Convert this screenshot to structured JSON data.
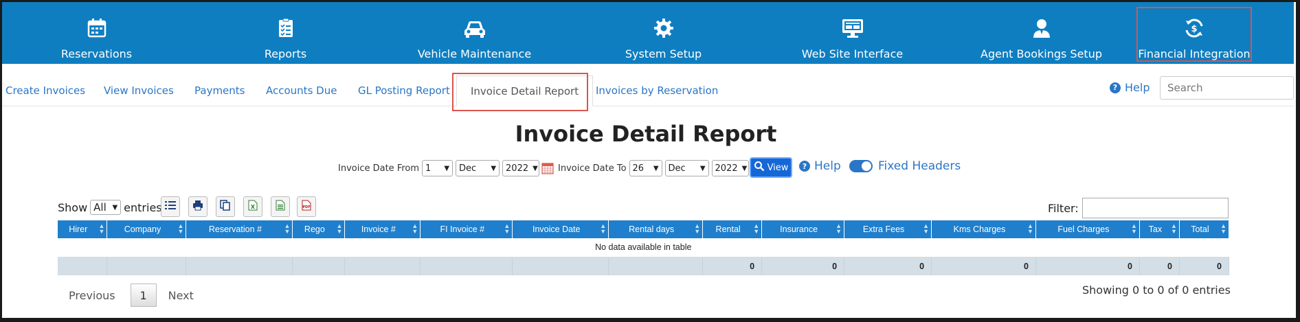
{
  "top_nav": [
    {
      "label": "Reservations",
      "icon": "calendar-icon"
    },
    {
      "label": "Reports",
      "icon": "clipboard-list-icon"
    },
    {
      "label": "Vehicle Maintenance",
      "icon": "car-icon"
    },
    {
      "label": "System Setup",
      "icon": "gear-icon"
    },
    {
      "label": "Web Site Interface",
      "icon": "monitor-icon"
    },
    {
      "label": "Agent Bookings Setup",
      "icon": "agent-icon"
    },
    {
      "label": "Financial Integration",
      "icon": "dollar-cycle-icon"
    }
  ],
  "sub_nav": {
    "tabs": [
      "Create Invoices",
      "View Invoices",
      "Payments",
      "Accounts Due",
      "GL Posting Report",
      "Invoice Detail Report",
      "Invoices by Reservation"
    ],
    "active_tab": "Invoice Detail Report",
    "help_label": "Help",
    "search_placeholder": "Search"
  },
  "report": {
    "title": "Invoice Detail Report",
    "from_label": "Invoice Date From",
    "from_day": "1",
    "from_month": "Dec",
    "from_year": "2022",
    "to_label": "Invoice Date To",
    "to_day": "26",
    "to_month": "Dec",
    "to_year": "2022",
    "view_label": "View",
    "help_label": "Help",
    "fixed_headers_label": "Fixed Headers",
    "fixed_headers_on": true
  },
  "table_controls": {
    "show_label": "Show",
    "show_value": "All",
    "entries_label": "entries",
    "filter_label": "Filter:",
    "tools": [
      "list-icon",
      "print-icon",
      "copy-icon",
      "excel-icon",
      "csv-icon",
      "pdf-icon"
    ]
  },
  "table": {
    "columns": [
      "Hirer",
      "Company",
      "Reservation #",
      "Rego",
      "Invoice #",
      "FI Invoice #",
      "Invoice Date",
      "Rental days",
      "Rental",
      "Insurance",
      "Extra Fees",
      "Kms Charges",
      "Fuel Charges",
      "Tax",
      "Total"
    ],
    "empty_message": "No data available in table",
    "footer": [
      "",
      "",
      "",
      "",
      "",
      "",
      "",
      "",
      "0",
      "0",
      "0",
      "0",
      "0",
      "0",
      "0"
    ]
  },
  "pagination": {
    "previous": "Previous",
    "page": "1",
    "next": "Next",
    "info": "Showing 0 to 0 of 0 entries"
  },
  "colors": {
    "nav_bg": "#0e7ec1",
    "link": "#2a76c6",
    "header_bg": "#1f7fcc",
    "highlight": "#d9534f"
  }
}
